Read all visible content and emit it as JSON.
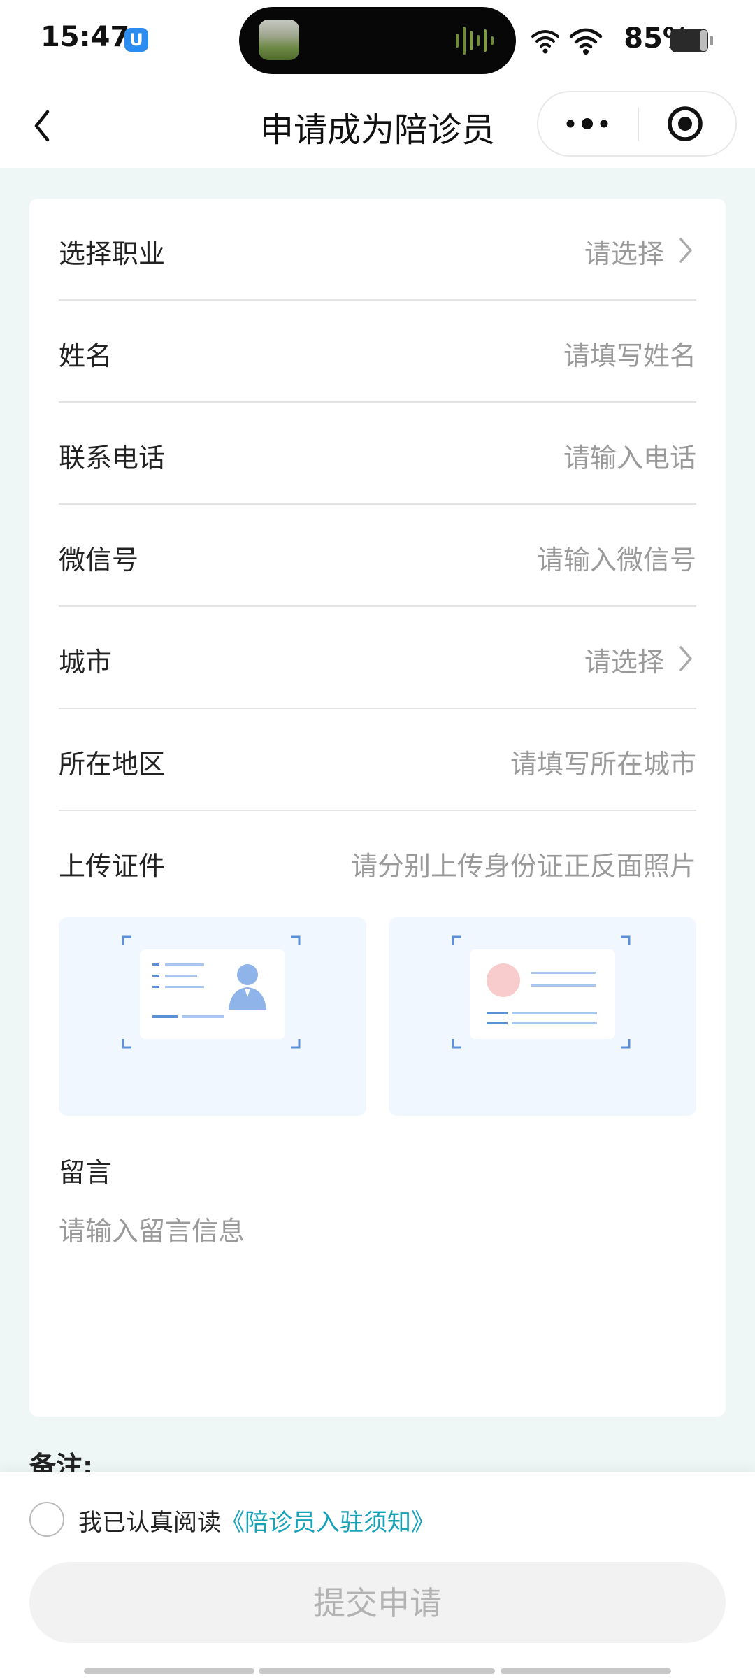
{
  "status_bar": {
    "time": "15:47",
    "app_badge_icon": "u-shield-badge-icon",
    "battery_percent": "85%",
    "icons": [
      "wifi-icon",
      "wifi-icon",
      "battery-icon"
    ]
  },
  "nav": {
    "title": "申请成为陪诊员",
    "back_icon": "chevron-left-icon",
    "more_icon": "more-dots-icon",
    "close_icon": "target-close-icon"
  },
  "form": {
    "rows": [
      {
        "label": "选择职业",
        "value": "请选择",
        "type": "select"
      },
      {
        "label": "姓名",
        "value": "请填写姓名",
        "type": "input"
      },
      {
        "label": "联系电话",
        "value": "请输入电话",
        "type": "input"
      },
      {
        "label": "微信号",
        "value": "请输入微信号",
        "type": "input"
      },
      {
        "label": "城市",
        "value": "请选择",
        "type": "select"
      },
      {
        "label": "所在地区",
        "value": "请填写所在城市",
        "type": "input"
      }
    ],
    "upload": {
      "label": "上传证件",
      "hint": "请分别上传身份证正反面照片",
      "front_icon": "id-card-front-icon",
      "back_icon": "id-card-back-icon"
    },
    "message": {
      "label": "留言",
      "placeholder": "请输入留言信息"
    }
  },
  "remark_label": "备注:",
  "footer": {
    "agree_prefix": "我已认真阅读",
    "agree_link": "《陪诊员入驻须知》",
    "submit_label": "提交申请"
  },
  "colors": {
    "accent_link": "#17a2b8",
    "placeholder": "#9a9a9a",
    "disabled_button_bg": "#f2f2f2",
    "disabled_button_text": "#b3b3b3",
    "card_bg": "#ffffff",
    "page_bg": "#eef6f6"
  }
}
